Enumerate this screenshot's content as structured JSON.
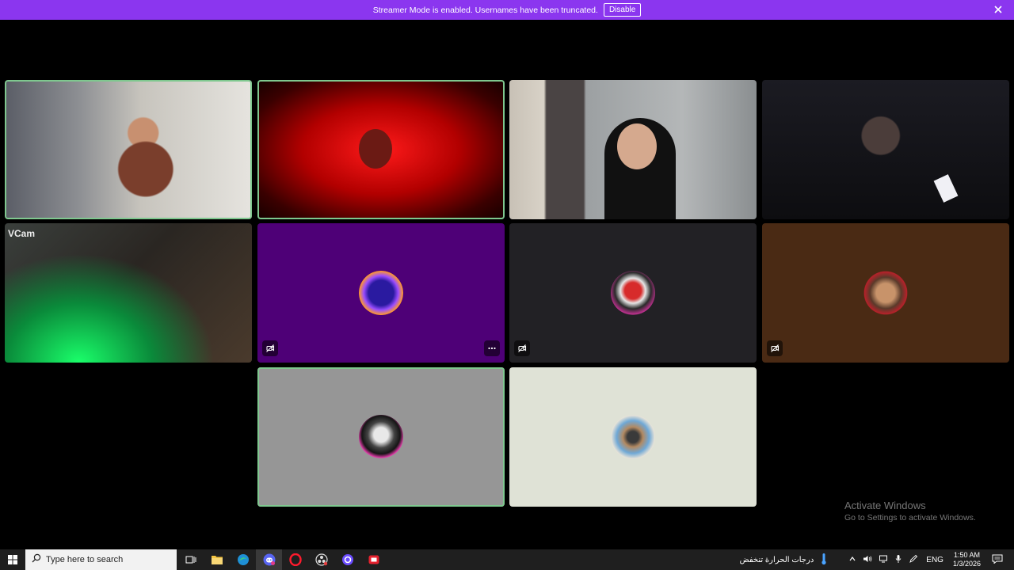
{
  "banner": {
    "message": "Streamer Mode is enabled. Usernames have been truncated.",
    "disable_label": "Disable",
    "close_icon": "close-icon"
  },
  "tiles": [
    {
      "name": "video-tile-1",
      "kind": "video",
      "speaking": true
    },
    {
      "name": "video-tile-2",
      "kind": "video",
      "speaking": true
    },
    {
      "name": "video-tile-3",
      "kind": "video",
      "speaking": false
    },
    {
      "name": "video-tile-4",
      "kind": "video",
      "speaking": false
    },
    {
      "name": "video-tile-5",
      "kind": "video",
      "speaking": false,
      "overlay_text": "VCam"
    },
    {
      "name": "avatar-tile-purple",
      "kind": "avatar",
      "background": "#4e0077",
      "muted_icon": "camera-off-icon",
      "more_icon": "more-options-icon"
    },
    {
      "name": "avatar-tile-dark",
      "kind": "avatar",
      "background": "#222125",
      "muted_icon": "camera-off-icon"
    },
    {
      "name": "avatar-tile-brown",
      "kind": "avatar",
      "background": "#4a2a14",
      "muted_icon": "camera-off-icon"
    },
    {
      "name": "avatar-tile-gray",
      "kind": "avatar",
      "background": "#969696",
      "speaking": true
    },
    {
      "name": "avatar-tile-light",
      "kind": "avatar",
      "background": "#dfe2d6"
    }
  ],
  "watermark": {
    "title": "Activate Windows",
    "subtitle": "Go to Settings to activate Windows."
  },
  "taskbar": {
    "search_placeholder": "Type here to search",
    "apps": [
      "task-view-icon",
      "file-explorer-icon",
      "edge-icon",
      "discord-icon",
      "opera-icon",
      "obs-icon",
      "app-icon",
      "app-icon"
    ],
    "weather_text": "درجات الحرارة تنخفض",
    "language": "ENG",
    "time": "1:50 AM",
    "date": "1/3/2026"
  },
  "colors": {
    "banner": "#8b36ef",
    "speaking_border": "#7fc88f",
    "taskbar": "#1f1f1f"
  }
}
